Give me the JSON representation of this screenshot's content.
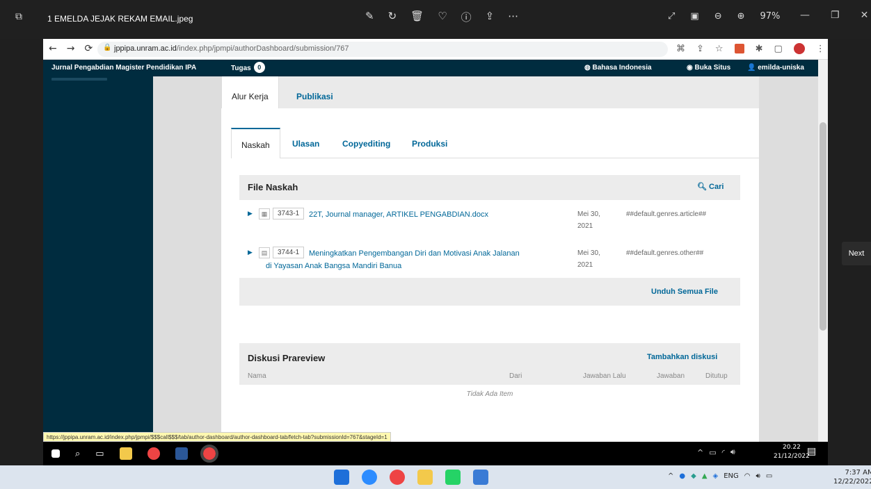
{
  "viewer": {
    "title": "1 EMELDA JEJAK REKAM EMAIL.jpeg",
    "zoom": "97%",
    "next_label": "Next"
  },
  "browser": {
    "url_host": "jppipa.unram.ac.id",
    "url_path": "/index.php/jpmpi/authorDashboard/submission/767",
    "status_url": "https://jppipa.unram.ac.id/index.php/jpmpi/$$$call$$$/tab/author-dashboard/author-dashboard-tab/fetch-tab?submissionId=767&stageId=1"
  },
  "header": {
    "site_name": "Jurnal Pengabdian Magister Pendidikan IPA",
    "tasks_label": "Tugas",
    "tasks_count": "0",
    "language": "Bahasa Indonesia",
    "view_site": "Buka Situs",
    "username": "emilda-uniska"
  },
  "top_tabs": [
    {
      "label": "Alur Kerja"
    },
    {
      "label": "Publikasi"
    }
  ],
  "stage_tabs": [
    {
      "label": "Naskah"
    },
    {
      "label": "Ulasan"
    },
    {
      "label": "Copyediting"
    },
    {
      "label": "Produksi"
    }
  ],
  "files": {
    "title": "File Naskah",
    "search": "Cari",
    "rows": [
      {
        "id": "3743-1",
        "name": "22T, Journal manager, ARTIKEL PENGABDIAN.docx",
        "date_line1": "Mei 30,",
        "date_line2": "2021",
        "genre": "##default.genres.article##"
      },
      {
        "id": "3744-1",
        "name": "Meningkatkan Pengembangan Diri dan Motivasi Anak Jalanan",
        "name2": "di Yayasan Anak Bangsa Mandiri Banua",
        "date_line1": "Mei 30,",
        "date_line2": "2021",
        "genre": "##default.genres.other##"
      }
    ],
    "download_all": "Unduh Semua File"
  },
  "discussions": {
    "title": "Diskusi Prareview",
    "add": "Tambahkan diskusi",
    "columns": [
      "Nama",
      "Dari",
      "Jawaban Lalu",
      "Jawaban",
      "Ditutup"
    ],
    "empty": "Tidak Ada Item"
  },
  "inner_taskbar": {
    "time": "20.22",
    "date": "21/12/2022"
  },
  "outer_taskbar": {
    "lang": "ENG",
    "time": "7:37 AM",
    "date": "12/22/2022"
  }
}
